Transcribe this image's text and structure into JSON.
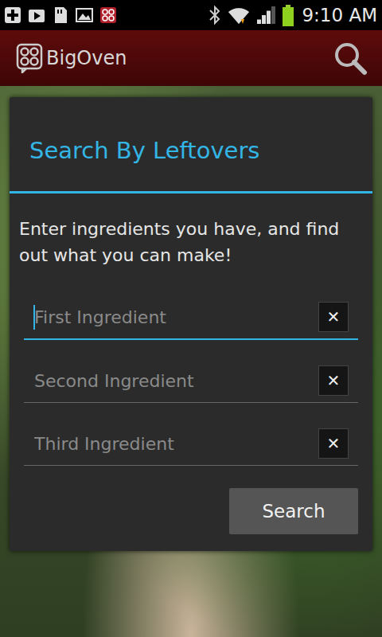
{
  "status_bar": {
    "time": "9:10 AM",
    "battery": {
      "level": 1
    },
    "signal": {
      "level": 0.75
    },
    "wifi": {
      "level": 1
    }
  },
  "app_bar": {
    "title": "BigOven"
  },
  "dialog": {
    "title": "Search By Leftovers",
    "message": "Enter ingredients you have, and find out what you can make!",
    "fields": [
      {
        "placeholder": "First Ingredient",
        "value": "",
        "focused": true,
        "clear": "✕"
      },
      {
        "placeholder": "Second Ingredient",
        "value": "",
        "focused": false,
        "clear": "✕"
      },
      {
        "placeholder": "Third Ingredient",
        "value": "",
        "focused": false,
        "clear": "✕"
      }
    ],
    "buttons": [
      "Search"
    ]
  }
}
